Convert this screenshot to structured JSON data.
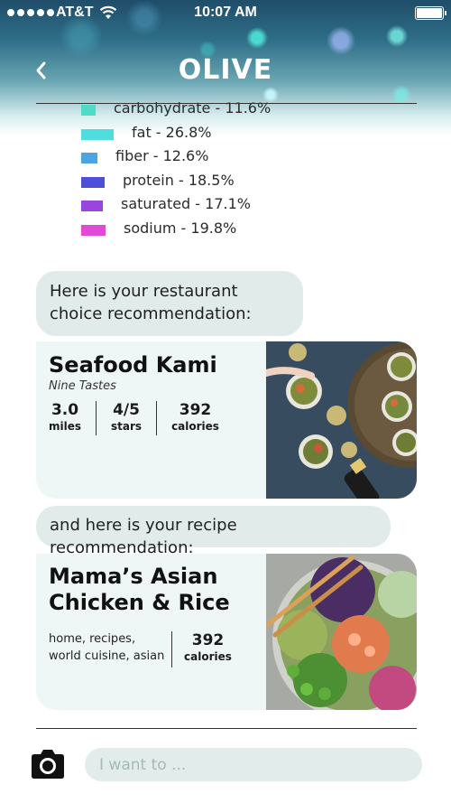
{
  "status_bar": {
    "carrier": "AT&T",
    "time": "10:07 AM"
  },
  "header": {
    "title": "OLIVE"
  },
  "legend": [
    {
      "label": "carbohydrate - 11.6%",
      "color": "#4fdcc6",
      "swatch_w": 16,
      "text_x": 36
    },
    {
      "label": "fat - 26.8%",
      "color": "#4fdde0",
      "swatch_w": 36,
      "text_x": 56
    },
    {
      "label": "fiber - 12.6%",
      "color": "#4aa6e3",
      "swatch_w": 18,
      "text_x": 38
    },
    {
      "label": "protein - 18.5%",
      "color": "#4d4fd9",
      "swatch_w": 26,
      "text_x": 46
    },
    {
      "label": "saturated - 17.1%",
      "color": "#9a45dd",
      "swatch_w": 24,
      "text_x": 44
    },
    {
      "label": "sodium - 19.8%",
      "color": "#e14ad8",
      "swatch_w": 27,
      "text_x": 47
    }
  ],
  "chat": {
    "restaurant_intro": "Here is your restaurant choice recommendation:",
    "recipe_intro": "and here is your recipe recommendation:"
  },
  "restaurant": {
    "name": "Seafood Kami",
    "subtitle": "Nine Tastes",
    "distance_value": "3.0",
    "distance_label": "miles",
    "rating_value": "4/5",
    "rating_label": "stars",
    "calories_value": "392",
    "calories_label": "calories"
  },
  "recipe": {
    "name_line1": "Mama’s Asian",
    "name_line2": "Chicken & Rice",
    "tags": "home, recipes, world cuisine, asian",
    "calories_value": "392",
    "calories_label": "calories"
  },
  "input": {
    "placeholder": "I want to ..."
  }
}
